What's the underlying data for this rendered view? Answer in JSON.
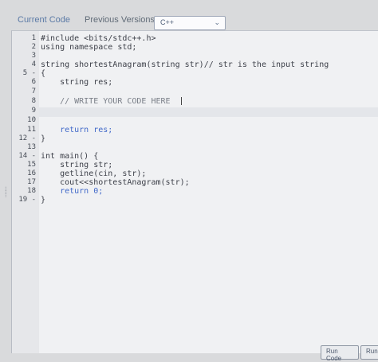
{
  "tabs": {
    "current_code": "Current Code",
    "previous_versions": "Previous Versions"
  },
  "language_select": {
    "value": "C++"
  },
  "editor": {
    "lines": [
      {
        "n": "1",
        "text": "#include <bits/stdc++.h>"
      },
      {
        "n": "2",
        "text": "using namespace std;"
      },
      {
        "n": "3",
        "text": ""
      },
      {
        "n": "4",
        "text": "string shortestAnagram(string str)// str is the input string"
      },
      {
        "n": "5 -",
        "text": "{"
      },
      {
        "n": "6",
        "text": "    string res;"
      },
      {
        "n": "7",
        "text": ""
      },
      {
        "n": "8",
        "text": "    // WRITE YOUR CODE HERE"
      },
      {
        "n": "9",
        "text": ""
      },
      {
        "n": "10",
        "text": ""
      },
      {
        "n": "11",
        "text": "    return res;"
      },
      {
        "n": "12 -",
        "text": "}"
      },
      {
        "n": "13",
        "text": ""
      },
      {
        "n": "14 -",
        "text": "int main() {"
      },
      {
        "n": "15",
        "text": "    string str;"
      },
      {
        "n": "16",
        "text": "    getline(cin, str);"
      },
      {
        "n": "17",
        "text": "    cout<<shortestAnagram(str);"
      },
      {
        "n": "18",
        "text": "    return 0;"
      },
      {
        "n": "19 -",
        "text": "}"
      }
    ]
  },
  "buttons": {
    "run_code": "Run Code",
    "run": "Run"
  }
}
